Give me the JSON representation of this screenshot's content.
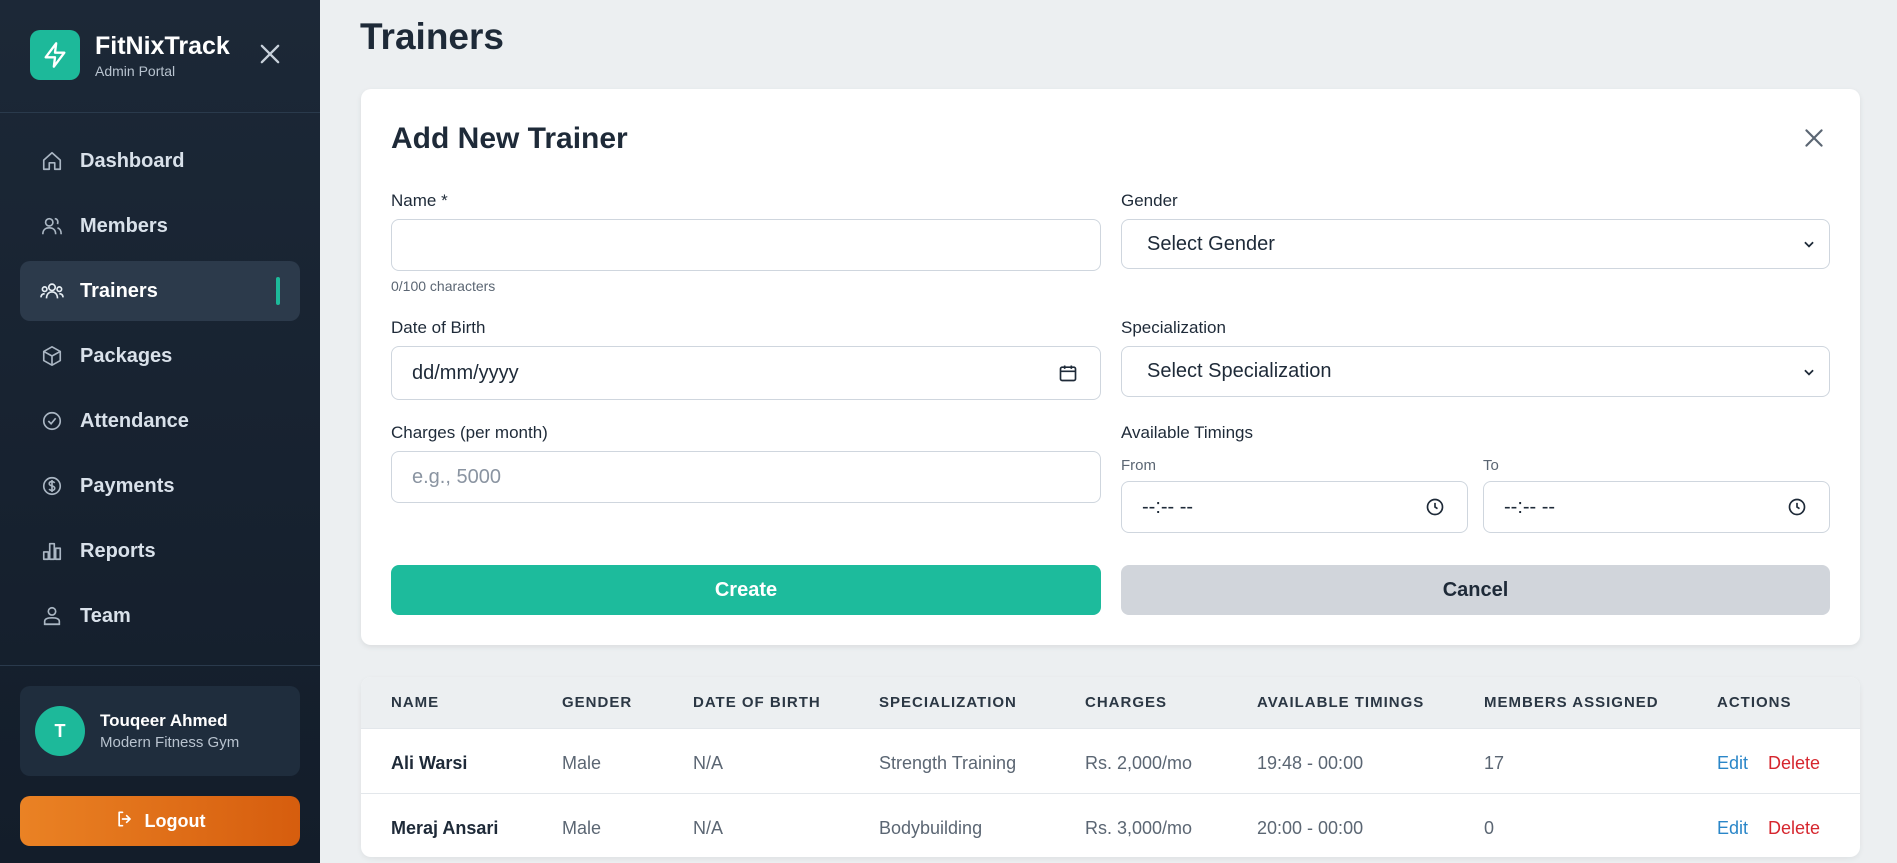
{
  "brand": {
    "title": "FitNixTrack",
    "subtitle": "Admin Portal",
    "logo_icon": "lightning-icon",
    "accent": "#1db99a"
  },
  "sidebar": {
    "items": [
      {
        "label": "Dashboard",
        "icon": "home-icon",
        "active": false
      },
      {
        "label": "Members",
        "icon": "users-icon",
        "active": false
      },
      {
        "label": "Trainers",
        "icon": "user-group-icon",
        "active": true
      },
      {
        "label": "Packages",
        "icon": "cube-icon",
        "active": false
      },
      {
        "label": "Attendance",
        "icon": "check-circle-icon",
        "active": false
      },
      {
        "label": "Payments",
        "icon": "dollar-circle-icon",
        "active": false
      },
      {
        "label": "Reports",
        "icon": "bar-chart-icon",
        "active": false
      },
      {
        "label": "Team",
        "icon": "user-badge-icon",
        "active": false
      }
    ],
    "user": {
      "initial": "T",
      "name": "Touqeer Ahmed",
      "org": "Modern Fitness Gym"
    },
    "logout_label": "Logout"
  },
  "page": {
    "title": "Trainers"
  },
  "form": {
    "title": "Add New Trainer",
    "name": {
      "label": "Name *",
      "value": "",
      "hint": "0/100 characters"
    },
    "gender": {
      "label": "Gender",
      "selected": "Select Gender"
    },
    "dob": {
      "label": "Date of Birth",
      "placeholder": "dd/mm/yyyy"
    },
    "specialization": {
      "label": "Specialization",
      "selected": "Select Specialization"
    },
    "charges": {
      "label": "Charges (per month)",
      "placeholder": "e.g., 5000"
    },
    "timings": {
      "label": "Available Timings",
      "from_label": "From",
      "to_label": "To",
      "from_placeholder": "--:-- --",
      "to_placeholder": "--:-- --"
    },
    "create_label": "Create",
    "cancel_label": "Cancel"
  },
  "table": {
    "columns": [
      "NAME",
      "GENDER",
      "DATE OF BIRTH",
      "SPECIALIZATION",
      "CHARGES",
      "AVAILABLE TIMINGS",
      "MEMBERS ASSIGNED",
      "ACTIONS"
    ],
    "rows": [
      {
        "name": "Ali Warsi",
        "gender": "Male",
        "dob": "N/A",
        "specialization": "Strength Training",
        "charges": "Rs. 2,000/mo",
        "timings": "19:48 - 00:00",
        "members": "17",
        "edit": "Edit",
        "delete": "Delete"
      },
      {
        "name": "Meraj Ansari",
        "gender": "Male",
        "dob": "N/A",
        "specialization": "Bodybuilding",
        "charges": "Rs. 3,000/mo",
        "timings": "20:00 - 00:00",
        "members": "0",
        "edit": "Edit",
        "delete": "Delete"
      }
    ]
  }
}
